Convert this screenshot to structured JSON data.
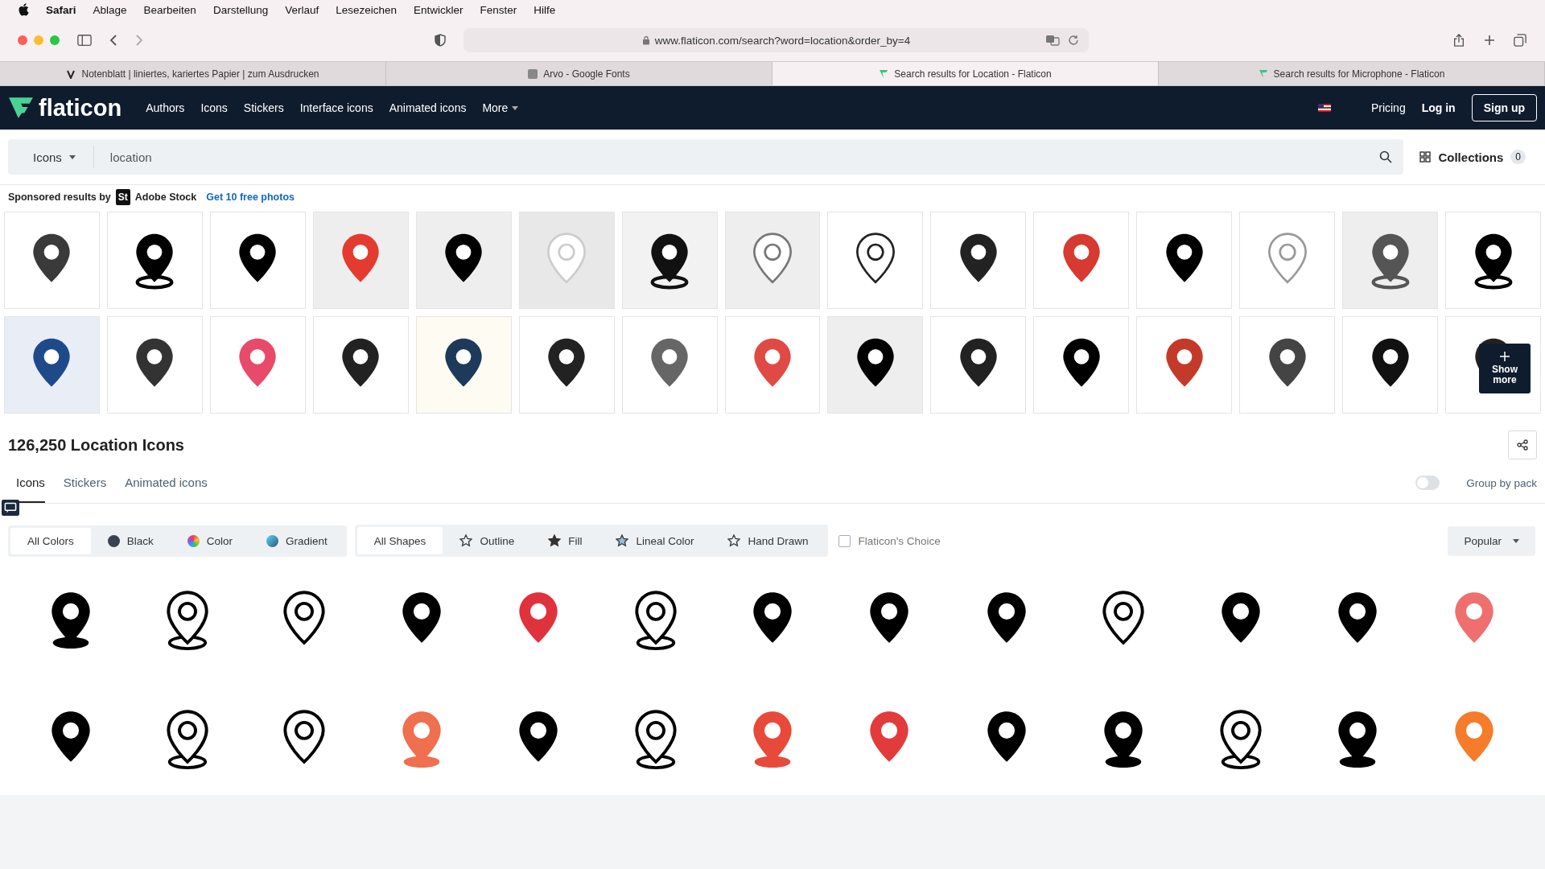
{
  "menu_bar": {
    "app": "Safari",
    "items": [
      "Ablage",
      "Bearbeiten",
      "Darstellung",
      "Verlauf",
      "Lesezeichen",
      "Entwickler",
      "Fenster",
      "Hilfe"
    ]
  },
  "address_bar": {
    "url": "www.flaticon.com/search?word=location&order_by=4"
  },
  "browser_tabs": [
    {
      "title": "Notenblatt | liniertes, kariertes Papier | zum Ausdrucken",
      "selected": false
    },
    {
      "title": "Arvo - Google Fonts",
      "selected": false
    },
    {
      "title": "Search results for Location - Flaticon",
      "selected": true
    },
    {
      "title": "Search results for Microphone - Flaticon",
      "selected": false
    }
  ],
  "site_nav": {
    "logo": "flaticon",
    "links": [
      "Authors",
      "Icons",
      "Stickers",
      "Interface icons",
      "Animated icons",
      "More"
    ],
    "right_links": [
      "Pricing",
      "Log in"
    ],
    "signup": "Sign up"
  },
  "search": {
    "type": "Icons",
    "value": "location",
    "collections": "Collections",
    "collections_count": "0"
  },
  "sponsored": {
    "label": "Sponsored results by",
    "brand_mark": "St",
    "brand": "Adobe Stock",
    "link": "Get 10 free photos",
    "show_more": "Show more"
  },
  "results": {
    "heading": "126,250 Location Icons",
    "tabs": [
      {
        "label": "Icons",
        "selected": true
      },
      {
        "label": "Stickers",
        "selected": false
      },
      {
        "label": "Animated icons",
        "selected": false
      }
    ],
    "group_by_pack": {
      "label": "Group by pack",
      "on": false
    },
    "color_filters": [
      {
        "label": "All Colors",
        "kind": "all",
        "selected": true
      },
      {
        "label": "Black",
        "kind": "solid",
        "selected": false
      },
      {
        "label": "Color",
        "kind": "multicolor",
        "selected": false
      },
      {
        "label": "Gradient",
        "kind": "gradient",
        "selected": false
      }
    ],
    "shape_filters": [
      {
        "label": "All Shapes",
        "kind": "all",
        "selected": true
      },
      {
        "label": "Outline",
        "kind": "outline",
        "selected": false
      },
      {
        "label": "Fill",
        "kind": "fill",
        "selected": false
      },
      {
        "label": "Lineal Color",
        "kind": "lineal",
        "selected": false
      },
      {
        "label": "Hand Drawn",
        "kind": "hand",
        "selected": false
      }
    ],
    "choice": {
      "label": "Flaticon's Choice",
      "checked": false
    },
    "sort": "Popular"
  }
}
